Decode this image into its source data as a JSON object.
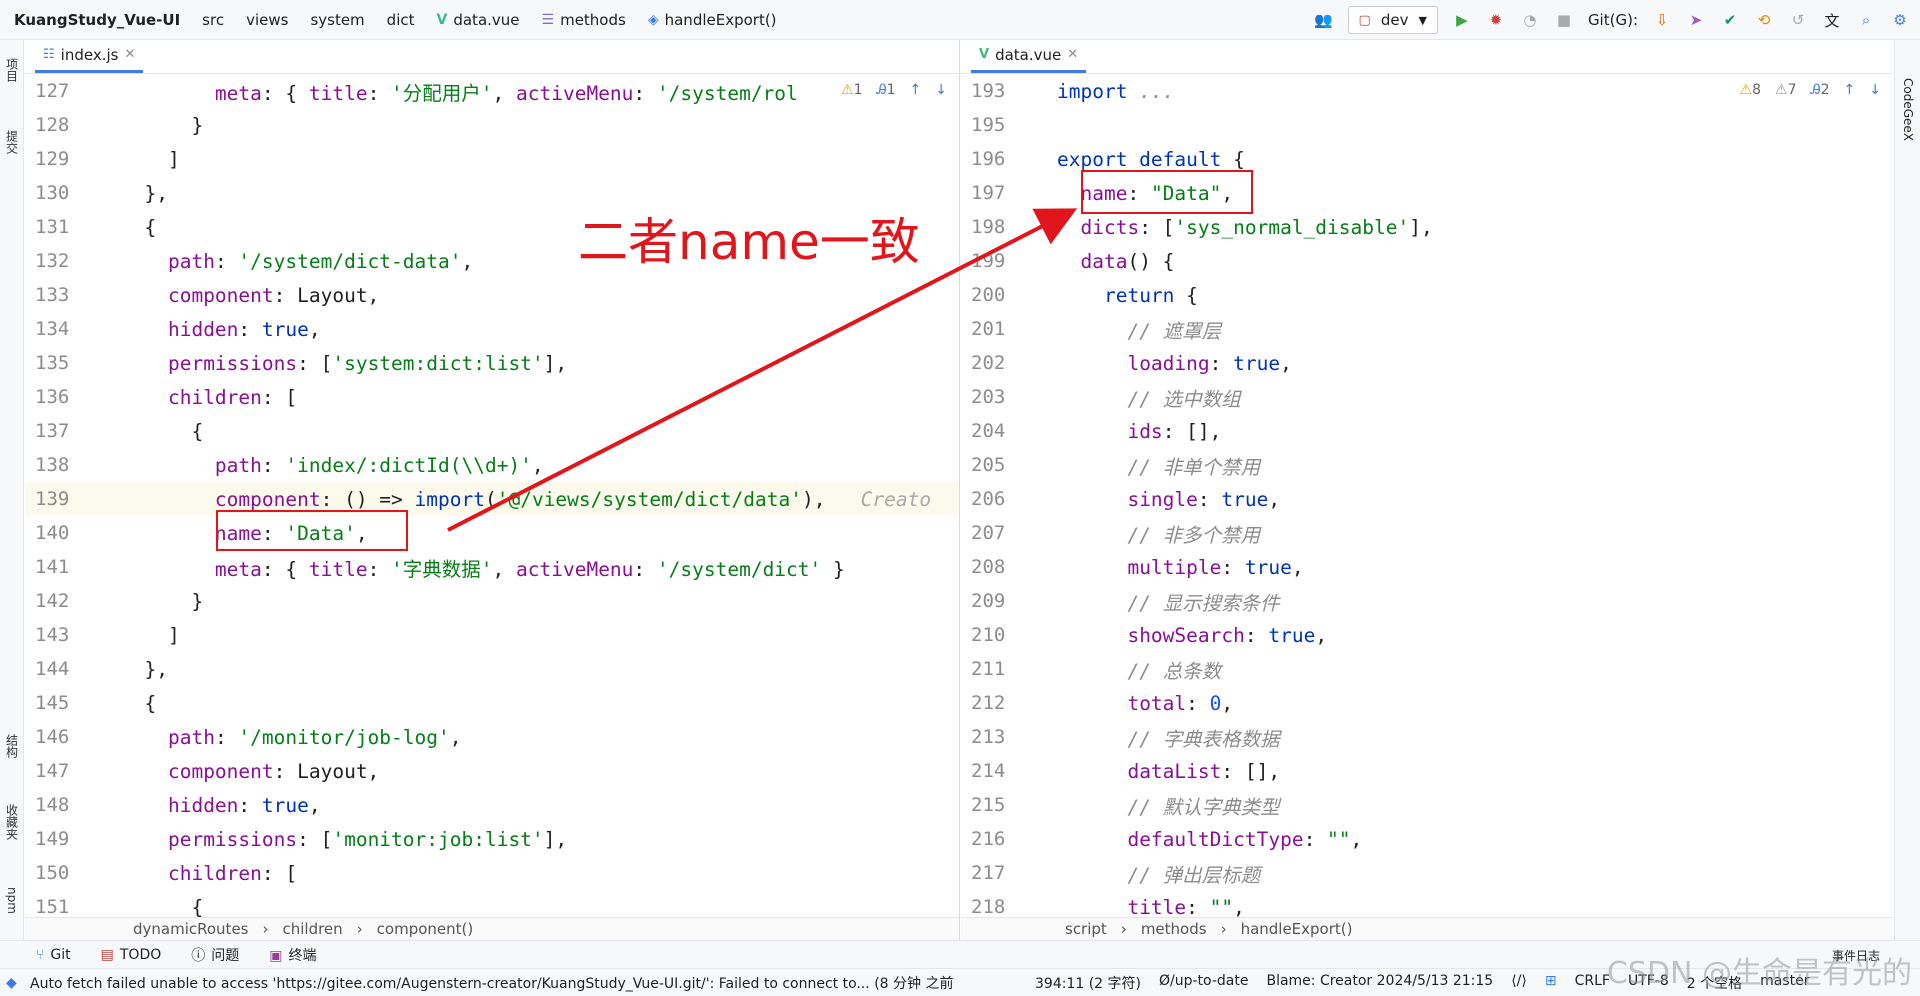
{
  "topbar": {
    "project": "KuangStudy_Vue-UI",
    "crumbs": [
      "src",
      "views",
      "system",
      "dict",
      "data.vue",
      "methods",
      "handleExport()"
    ],
    "branch_select": "dev",
    "git_label": "Git(G):"
  },
  "left_strip": [
    "项目",
    "提交",
    "结构",
    "收藏夹",
    "npm"
  ],
  "right_strip": [
    "CodeGeeX"
  ],
  "left_pane": {
    "tab": "index.js",
    "inspect": {
      "warn": "1",
      "typo": "1"
    },
    "lines": [
      {
        "n": "127",
        "indent": 8,
        "parts": [
          [
            "prop",
            "meta"
          ],
          [
            "pun",
            ": { "
          ],
          [
            "prop",
            "title"
          ],
          [
            "pun",
            ": "
          ],
          [
            "str",
            "'分配用户'"
          ],
          [
            "pun",
            ", "
          ],
          [
            "prop",
            "activeMenu"
          ],
          [
            "pun",
            ": "
          ],
          [
            "str",
            "'/system/rol"
          ]
        ]
      },
      {
        "n": "128",
        "indent": 6,
        "parts": [
          [
            "pun",
            "}"
          ]
        ]
      },
      {
        "n": "129",
        "indent": 4,
        "parts": [
          [
            "pun",
            "]"
          ]
        ]
      },
      {
        "n": "130",
        "indent": 2,
        "parts": [
          [
            "pun",
            "},"
          ]
        ]
      },
      {
        "n": "131",
        "indent": 2,
        "parts": [
          [
            "pun",
            "{"
          ]
        ]
      },
      {
        "n": "132",
        "indent": 4,
        "parts": [
          [
            "prop",
            "path"
          ],
          [
            "pun",
            ": "
          ],
          [
            "str",
            "'/system/dict-data'"
          ],
          [
            "pun",
            ","
          ]
        ]
      },
      {
        "n": "133",
        "indent": 4,
        "parts": [
          [
            "prop",
            "component"
          ],
          [
            "pun",
            ": Layout,"
          ]
        ]
      },
      {
        "n": "134",
        "indent": 4,
        "parts": [
          [
            "prop",
            "hidden"
          ],
          [
            "pun",
            ": "
          ],
          [
            "kw",
            "true"
          ],
          [
            "pun",
            ","
          ]
        ]
      },
      {
        "n": "135",
        "indent": 4,
        "parts": [
          [
            "prop",
            "permissions"
          ],
          [
            "pun",
            ": ["
          ],
          [
            "str",
            "'system:dict:list'"
          ],
          [
            "pun",
            "],"
          ]
        ]
      },
      {
        "n": "136",
        "indent": 4,
        "parts": [
          [
            "prop",
            "children"
          ],
          [
            "pun",
            ": ["
          ]
        ]
      },
      {
        "n": "137",
        "indent": 6,
        "parts": [
          [
            "pun",
            "{"
          ]
        ]
      },
      {
        "n": "138",
        "indent": 8,
        "parts": [
          [
            "prop",
            "path"
          ],
          [
            "pun",
            ": "
          ],
          [
            "str",
            "'index/:dictId(\\\\d+)'"
          ],
          [
            "pun",
            ","
          ]
        ]
      },
      {
        "n": "139",
        "indent": 8,
        "parts": [
          [
            "prop",
            "component"
          ],
          [
            "pun",
            ": () => "
          ],
          [
            "kw",
            "import"
          ],
          [
            "pun",
            "("
          ],
          [
            "str",
            "'@/views/system/dict/data'"
          ],
          [
            "pun",
            "),   "
          ],
          [
            "hint",
            "Creato"
          ]
        ]
      },
      {
        "n": "140",
        "indent": 8,
        "parts": [
          [
            "prop",
            "name"
          ],
          [
            "pun",
            ": "
          ],
          [
            "str",
            "'Data'"
          ],
          [
            "pun",
            ","
          ]
        ]
      },
      {
        "n": "141",
        "indent": 8,
        "parts": [
          [
            "prop",
            "meta"
          ],
          [
            "pun",
            ": { "
          ],
          [
            "prop",
            "title"
          ],
          [
            "pun",
            ": "
          ],
          [
            "str",
            "'字典数据'"
          ],
          [
            "pun",
            ", "
          ],
          [
            "prop",
            "activeMenu"
          ],
          [
            "pun",
            ": "
          ],
          [
            "str",
            "'/system/dict'"
          ],
          [
            "pun",
            " }"
          ]
        ]
      },
      {
        "n": "142",
        "indent": 6,
        "parts": [
          [
            "pun",
            "}"
          ]
        ]
      },
      {
        "n": "143",
        "indent": 4,
        "parts": [
          [
            "pun",
            "]"
          ]
        ]
      },
      {
        "n": "144",
        "indent": 2,
        "parts": [
          [
            "pun",
            "},"
          ]
        ]
      },
      {
        "n": "145",
        "indent": 2,
        "parts": [
          [
            "pun",
            "{"
          ]
        ]
      },
      {
        "n": "146",
        "indent": 4,
        "parts": [
          [
            "prop",
            "path"
          ],
          [
            "pun",
            ": "
          ],
          [
            "str",
            "'/monitor/job-log'"
          ],
          [
            "pun",
            ","
          ]
        ]
      },
      {
        "n": "147",
        "indent": 4,
        "parts": [
          [
            "prop",
            "component"
          ],
          [
            "pun",
            ": Layout,"
          ]
        ]
      },
      {
        "n": "148",
        "indent": 4,
        "parts": [
          [
            "prop",
            "hidden"
          ],
          [
            "pun",
            ": "
          ],
          [
            "kw",
            "true"
          ],
          [
            "pun",
            ","
          ]
        ]
      },
      {
        "n": "149",
        "indent": 4,
        "parts": [
          [
            "prop",
            "permissions"
          ],
          [
            "pun",
            ": ["
          ],
          [
            "str",
            "'monitor:job:list'"
          ],
          [
            "pun",
            "],"
          ]
        ]
      },
      {
        "n": "150",
        "indent": 4,
        "parts": [
          [
            "prop",
            "children"
          ],
          [
            "pun",
            ": ["
          ]
        ]
      },
      {
        "n": "151",
        "indent": 6,
        "parts": [
          [
            "pun",
            "{"
          ]
        ]
      }
    ],
    "breadcrumbs": [
      "dynamicRoutes",
      "children",
      "component()"
    ]
  },
  "right_pane": {
    "tab": "data.vue",
    "inspect": {
      "warn": "8",
      "weak": "7",
      "typo": "2"
    },
    "lines": [
      {
        "n": "193",
        "indent": 0,
        "parts": [
          [
            "kw",
            "import"
          ],
          [
            "pun",
            " "
          ],
          [
            "cmt",
            "..."
          ]
        ]
      },
      {
        "n": "195",
        "indent": 0,
        "parts": []
      },
      {
        "n": "196",
        "indent": 0,
        "parts": [
          [
            "kw",
            "export default"
          ],
          [
            "pun",
            " {"
          ]
        ]
      },
      {
        "n": "197",
        "indent": 2,
        "parts": [
          [
            "prop",
            "name"
          ],
          [
            "pun",
            ": "
          ],
          [
            "str",
            "\"Data\""
          ],
          [
            "pun",
            ","
          ]
        ]
      },
      {
        "n": "198",
        "indent": 2,
        "parts": [
          [
            "prop",
            "dicts"
          ],
          [
            "pun",
            ": ["
          ],
          [
            "str",
            "'sys_normal_disable'"
          ],
          [
            "pun",
            "],"
          ]
        ]
      },
      {
        "n": "199",
        "indent": 2,
        "parts": [
          [
            "prop",
            "data"
          ],
          [
            "pun",
            "() {"
          ]
        ]
      },
      {
        "n": "200",
        "indent": 4,
        "parts": [
          [
            "kw",
            "return"
          ],
          [
            "pun",
            " {"
          ]
        ]
      },
      {
        "n": "201",
        "indent": 6,
        "parts": [
          [
            "cmt",
            "// 遮罩层"
          ]
        ]
      },
      {
        "n": "202",
        "indent": 6,
        "parts": [
          [
            "prop",
            "loading"
          ],
          [
            "pun",
            ": "
          ],
          [
            "kw",
            "true"
          ],
          [
            "pun",
            ","
          ]
        ]
      },
      {
        "n": "203",
        "indent": 6,
        "parts": [
          [
            "cmt",
            "// 选中数组"
          ]
        ]
      },
      {
        "n": "204",
        "indent": 6,
        "parts": [
          [
            "prop",
            "ids"
          ],
          [
            "pun",
            ": [],"
          ]
        ]
      },
      {
        "n": "205",
        "indent": 6,
        "parts": [
          [
            "cmt",
            "// 非单个禁用"
          ]
        ]
      },
      {
        "n": "206",
        "indent": 6,
        "parts": [
          [
            "prop",
            "single"
          ],
          [
            "pun",
            ": "
          ],
          [
            "kw",
            "true"
          ],
          [
            "pun",
            ","
          ]
        ]
      },
      {
        "n": "207",
        "indent": 6,
        "parts": [
          [
            "cmt",
            "// 非多个禁用"
          ]
        ]
      },
      {
        "n": "208",
        "indent": 6,
        "parts": [
          [
            "prop",
            "multiple"
          ],
          [
            "pun",
            ": "
          ],
          [
            "kw",
            "true"
          ],
          [
            "pun",
            ","
          ]
        ]
      },
      {
        "n": "209",
        "indent": 6,
        "parts": [
          [
            "cmt",
            "// 显示搜索条件"
          ]
        ]
      },
      {
        "n": "210",
        "indent": 6,
        "parts": [
          [
            "prop",
            "showSearch"
          ],
          [
            "pun",
            ": "
          ],
          [
            "kw",
            "true"
          ],
          [
            "pun",
            ","
          ]
        ]
      },
      {
        "n": "211",
        "indent": 6,
        "parts": [
          [
            "cmt",
            "// 总条数"
          ]
        ]
      },
      {
        "n": "212",
        "indent": 6,
        "parts": [
          [
            "prop",
            "total"
          ],
          [
            "pun",
            ": "
          ],
          [
            "num",
            "0"
          ],
          [
            "pun",
            ","
          ]
        ]
      },
      {
        "n": "213",
        "indent": 6,
        "parts": [
          [
            "cmt",
            "// 字典表格数据"
          ]
        ]
      },
      {
        "n": "214",
        "indent": 6,
        "parts": [
          [
            "prop",
            "dataList"
          ],
          [
            "pun",
            ": [],"
          ]
        ]
      },
      {
        "n": "215",
        "indent": 6,
        "parts": [
          [
            "cmt",
            "// 默认字典类型"
          ]
        ]
      },
      {
        "n": "216",
        "indent": 6,
        "parts": [
          [
            "prop",
            "defaultDictType"
          ],
          [
            "pun",
            ": "
          ],
          [
            "str",
            "\"\""
          ],
          [
            "pun",
            ","
          ]
        ]
      },
      {
        "n": "217",
        "indent": 6,
        "parts": [
          [
            "cmt",
            "// 弹出层标题"
          ]
        ]
      },
      {
        "n": "218",
        "indent": 6,
        "parts": [
          [
            "prop",
            "title"
          ],
          [
            "pun",
            ": "
          ],
          [
            "str",
            "\"\""
          ],
          [
            "pun",
            ","
          ]
        ]
      }
    ],
    "breadcrumbs": [
      "script",
      "methods",
      "handleExport()"
    ]
  },
  "annotation": "二者name一致",
  "tool_windows": [
    "Git",
    "TODO",
    "问题",
    "终端"
  ],
  "status": {
    "message": "Auto fetch failed unable to access 'https://gitee.com/Augenstern-creator/KuangStudy_Vue-UI.git/': Failed to connect to... (8 分钟 之前",
    "items": [
      "394:11 (2 字符)",
      "Ø/up-to-date",
      "Blame: Creator 2024/5/13 21:15",
      "CRLF",
      "UTF-8",
      "2 个空格",
      "master"
    ],
    "event_log": "事件日志"
  },
  "watermark": "CSDN @生命是有光的",
  "colors": {
    "keyword": "#0033b3",
    "property": "#871094",
    "string": "#067d17",
    "annotation": "#e0161c"
  }
}
